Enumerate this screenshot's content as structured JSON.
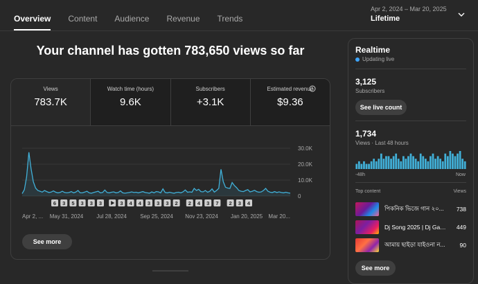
{
  "tabs": [
    "Overview",
    "Content",
    "Audience",
    "Revenue",
    "Trends"
  ],
  "date_range": {
    "sub": "Apr 2, 2024 – Mar 20, 2025",
    "main": "Lifetime"
  },
  "headline": "Your channel has gotten 783,650 views so far",
  "metrics": [
    {
      "label": "Views",
      "value": "783.7K"
    },
    {
      "label": "Watch time (hours)",
      "value": "9.6K"
    },
    {
      "label": "Subscribers",
      "value": "+3.1K"
    },
    {
      "label": "Estimated revenue",
      "value": "$9.36"
    }
  ],
  "icons": {
    "dropdown": "chevron-down-icon",
    "revenue_info": "clock-icon",
    "live": "status-dot-icon",
    "marker_play": "play-icon"
  },
  "colors": {
    "accent": "#3ea6ff",
    "line": "#41b0d8"
  },
  "chart_data": {
    "type": "line",
    "x_ticks": [
      "Apr 2, ...",
      "May 31, 2024",
      "Jul 28, 2024",
      "Sep 25, 2024",
      "Nov 23, 2024",
      "Jan 20, 2025",
      "Mar 20..."
    ],
    "y_ticks": [
      "30.0K",
      "20.0K",
      "10.0K",
      "0"
    ],
    "ylim": [
      0,
      30000
    ],
    "grid": true,
    "series": [
      {
        "values": [
          1500,
          4000,
          12000,
          27500,
          17000,
          9000,
          5000,
          3500,
          3000,
          2500,
          3500,
          2800,
          2200,
          2500,
          3200,
          2400,
          2000,
          2300,
          3000,
          2200,
          2000,
          2200,
          2800,
          2000,
          2500,
          3500,
          2000,
          2000,
          2500,
          3000,
          2000,
          1800,
          2200,
          2600,
          3000,
          2000,
          2200,
          3800,
          2200,
          2000,
          2400,
          2600,
          2000,
          2200,
          3200,
          2000,
          1800,
          2000,
          2200,
          2600,
          2200,
          2400,
          2000,
          2400,
          2800,
          2200,
          2000,
          1800,
          2600,
          2000,
          2800,
          2600,
          2000,
          4500,
          2200,
          2000,
          2400,
          2000,
          1800,
          2200,
          2400,
          2000,
          2600,
          3800,
          2400,
          2600,
          2400,
          4800,
          3500,
          4200,
          2800,
          2600,
          3500,
          2400,
          3000,
          4500,
          2500,
          3500,
          4800,
          16800,
          9000,
          5500,
          5000,
          4800,
          8500,
          6500,
          5200,
          3500,
          3000,
          2800,
          3500,
          4000,
          2600,
          3000,
          3600,
          2800,
          2400,
          2600,
          3500,
          4800,
          3000,
          2400,
          2200,
          2800,
          2200,
          2600,
          2200,
          2000,
          2400,
          2000,
          1800
        ]
      }
    ],
    "markers": [
      "6",
      "3",
      "5",
      "3",
      "3",
      "3",
      "play",
      "3",
      "4",
      "4",
      "3",
      "3",
      "3",
      "2",
      "2",
      "4",
      "3",
      "7",
      "2",
      "3",
      "4"
    ]
  },
  "main_see_more": "See more",
  "realtime": {
    "title": "Realtime",
    "status": "Updating live",
    "subs_value": "3,125",
    "subs_label": "Subscribers",
    "live_button": "See live count",
    "views_value": "1,734",
    "views_label": "Views · Last 48 hours",
    "axis_start": "-48h",
    "axis_end": "Now",
    "bars": [
      2,
      3,
      2,
      3,
      2,
      2,
      3,
      4,
      3,
      4,
      6,
      4,
      5,
      5,
      4,
      5,
      6,
      4,
      3,
      5,
      4,
      5,
      6,
      5,
      4,
      3,
      6,
      5,
      4,
      3,
      5,
      6,
      4,
      5,
      4,
      3,
      6,
      5,
      7,
      6,
      5,
      6,
      7,
      4,
      3
    ],
    "top_content_label": "Top content",
    "views_col_label": "Views",
    "top_content": [
      {
        "title": "পিকনিক ভিজে গান ২০...",
        "views": "738"
      },
      {
        "title": "Dj Song 2025 | Dj Gan ...",
        "views": "449"
      },
      {
        "title": "আমায় ছাইড়া যাইওনা ন...",
        "views": "90"
      }
    ],
    "see_more": "See more"
  }
}
